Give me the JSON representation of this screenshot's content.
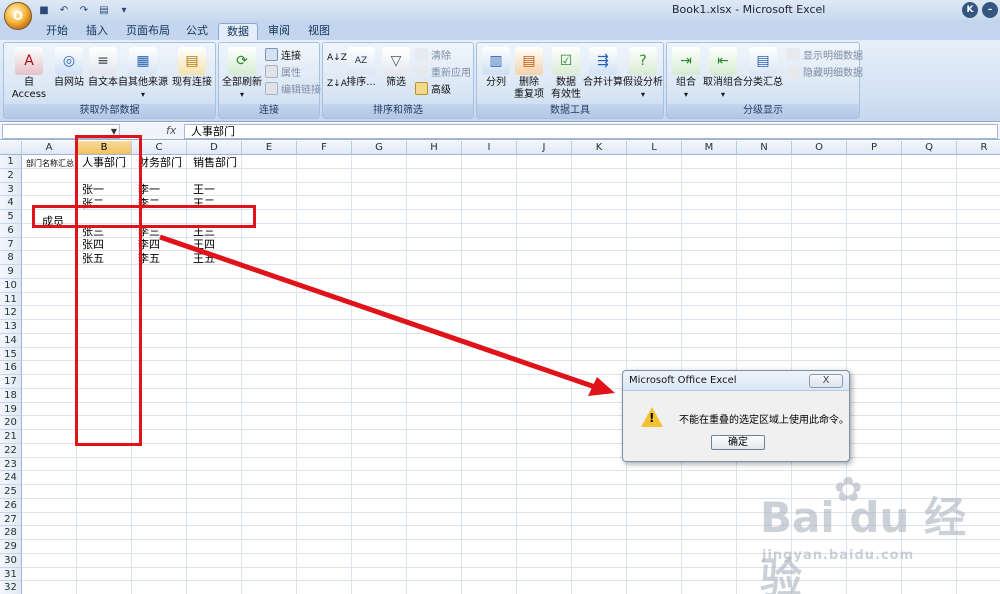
{
  "window": {
    "title": "Book1.xlsx - Microsoft Excel",
    "orb_label": "O"
  },
  "qat": [
    "save-icon",
    "undo-icon",
    "redo-icon",
    "print-icon",
    "customize-icon"
  ],
  "tabs": [
    {
      "id": "home",
      "label": "开始"
    },
    {
      "id": "insert",
      "label": "插入"
    },
    {
      "id": "layout",
      "label": "页面布局"
    },
    {
      "id": "formulas",
      "label": "公式"
    },
    {
      "id": "data",
      "label": "数据",
      "active": true
    },
    {
      "id": "review",
      "label": "审阅"
    },
    {
      "id": "view",
      "label": "视图"
    }
  ],
  "ribbon": {
    "groups": [
      {
        "label": "获取外部数据",
        "buttons": [
          "自 Access",
          "自网站",
          "自文本",
          "自其他来源",
          "现有连接"
        ]
      },
      {
        "label": "连接",
        "buttons": [
          "全部刷新"
        ],
        "small": [
          "连接",
          "属性",
          "编辑链接"
        ]
      },
      {
        "label": "排序和筛选",
        "buttons": [
          "排序...",
          "筛选"
        ],
        "small": [
          "清除",
          "重新应用",
          "高级"
        ]
      },
      {
        "label": "数据工具",
        "buttons": [
          "分列",
          "删除",
          "重复项",
          "数据",
          "有效性",
          "合并计算",
          "假设分析"
        ]
      },
      {
        "label": "分级显示",
        "buttons": [
          "组合",
          "取消组合",
          "分类汇总"
        ],
        "small": [
          "显示明细数据",
          "隐藏明细数据"
        ]
      }
    ]
  },
  "formula_bar": {
    "name_box": "",
    "fx": "fx",
    "value": "人事部门"
  },
  "columns": [
    "A",
    "B",
    "C",
    "D",
    "E",
    "F",
    "G",
    "H",
    "I",
    "J",
    "K",
    "L",
    "M",
    "N",
    "O",
    "P",
    "Q",
    "R"
  ],
  "rows": [
    "1",
    "2",
    "3",
    "4",
    "5",
    "6",
    "7",
    "8",
    "9",
    "10",
    "11",
    "12",
    "13",
    "14",
    "15",
    "16",
    "17",
    "18",
    "19",
    "20",
    "21",
    "22",
    "23",
    "24",
    "25",
    "26",
    "27",
    "28",
    "29",
    "30",
    "31",
    "32"
  ],
  "cells": {
    "A1": "部门名称汇总",
    "B1": "人事部门",
    "C1": "财务部门",
    "D1": "销售部门",
    "B3": "张一",
    "C3": "李一",
    "D3": "王一",
    "B4": "张二",
    "C4": "李二",
    "D4": "王二",
    "A5": "成员",
    "B6": "张三",
    "C6": "李三",
    "D6": "王三",
    "B7": "张四",
    "C7": "李四",
    "D7": "王四",
    "B8": "张五",
    "C8": "李五",
    "D8": "王五"
  },
  "dialog": {
    "title": "Microsoft Office Excel",
    "message": "不能在重叠的选定区域上使用此命令。",
    "ok": "确定",
    "close": "X"
  },
  "watermark": {
    "brand": "Bai du 经验",
    "url": "jingyan.baidu.com"
  },
  "colors": {
    "annotation": "#e0121a",
    "selected_header": "#f1c15f"
  }
}
